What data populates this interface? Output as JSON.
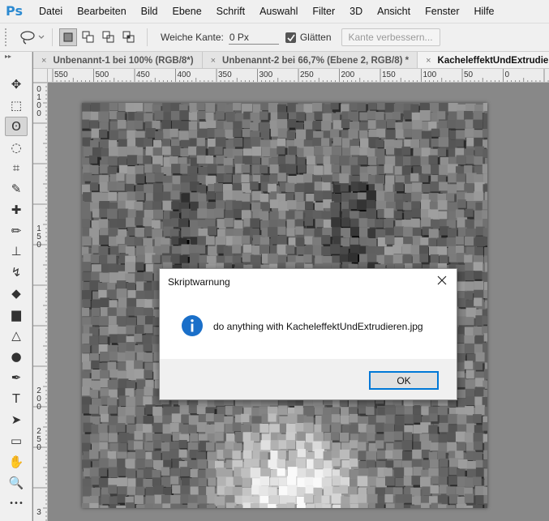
{
  "menubar": {
    "logo": "Ps",
    "items": [
      "Datei",
      "Bearbeiten",
      "Bild",
      "Ebene",
      "Schrift",
      "Auswahl",
      "Filter",
      "3D",
      "Ansicht",
      "Fenster",
      "Hilfe"
    ]
  },
  "options": {
    "feather_label": "Weiche Kante:",
    "feather_value": "0 Px",
    "antialias_label": "Glätten",
    "antialias_checked": true,
    "refine_button": "Kante verbessern..."
  },
  "toolbar": {
    "header": "▸▸",
    "tools": [
      {
        "name": "move-tool",
        "icon": "move-icon",
        "glyph": "✥"
      },
      {
        "name": "marquee-tool",
        "icon": "rect-marquee-icon",
        "glyph": "⬚"
      },
      {
        "name": "lasso-tool",
        "icon": "lasso-icon",
        "glyph": "ʘ",
        "active": true
      },
      {
        "name": "quick-select-tool",
        "icon": "quick-select-icon",
        "glyph": "◌"
      },
      {
        "name": "crop-tool",
        "icon": "crop-icon",
        "glyph": "⌗"
      },
      {
        "name": "eyedropper-tool",
        "icon": "eyedropper-icon",
        "glyph": "✎"
      },
      {
        "name": "healing-tool",
        "icon": "bandage-icon",
        "glyph": "✚"
      },
      {
        "name": "brush-tool",
        "icon": "brush-icon",
        "glyph": "✏"
      },
      {
        "name": "stamp-tool",
        "icon": "stamp-icon",
        "glyph": "⊥"
      },
      {
        "name": "history-brush-tool",
        "icon": "history-brush-icon",
        "glyph": "↯"
      },
      {
        "name": "eraser-tool",
        "icon": "eraser-icon",
        "glyph": "◆"
      },
      {
        "name": "gradient-tool",
        "icon": "gradient-icon",
        "glyph": "▆"
      },
      {
        "name": "blur-tool",
        "icon": "blur-icon",
        "glyph": "△"
      },
      {
        "name": "dodge-tool",
        "icon": "dodge-icon",
        "glyph": "●"
      },
      {
        "name": "pen-tool",
        "icon": "pen-icon",
        "glyph": "✒"
      },
      {
        "name": "type-tool",
        "icon": "type-icon",
        "glyph": "T"
      },
      {
        "name": "path-select-tool",
        "icon": "arrow-icon",
        "glyph": "➤"
      },
      {
        "name": "shape-tool",
        "icon": "rectangle-icon",
        "glyph": "▭"
      },
      {
        "name": "hand-tool",
        "icon": "hand-icon",
        "glyph": "✋"
      },
      {
        "name": "zoom-tool",
        "icon": "zoom-icon",
        "glyph": "🔍"
      },
      {
        "name": "more-tools",
        "icon": "more-icon",
        "glyph": "•••"
      }
    ]
  },
  "tabs": [
    {
      "label": "Unbenannt-1 bei 100% (RGB/8*)",
      "close": "×",
      "active": false
    },
    {
      "label": "Unbenannt-2 bei 66,7% (Ebene 2, RGB/8) *",
      "close": "×",
      "active": false
    },
    {
      "label": "KacheleffektUndExtrudieren",
      "close": "×",
      "active": true
    }
  ],
  "ruler_h": [
    "550",
    "500",
    "450",
    "400",
    "350",
    "300",
    "250",
    "200",
    "150",
    "100",
    "50",
    "0"
  ],
  "ruler_v": [
    "0",
    "1",
    "0",
    "0",
    "1",
    "5",
    "0",
    "2",
    "0",
    "0",
    "2",
    "5",
    "0",
    "3"
  ],
  "dialog": {
    "title": "Skriptwarnung",
    "message": "do anything with  KacheleffektUndExtrudieren.jpg",
    "ok_label": "OK"
  },
  "colors": {
    "accent": "#0078d7",
    "info_icon": "#1a6fc9",
    "logo": "#2c8ad1"
  }
}
